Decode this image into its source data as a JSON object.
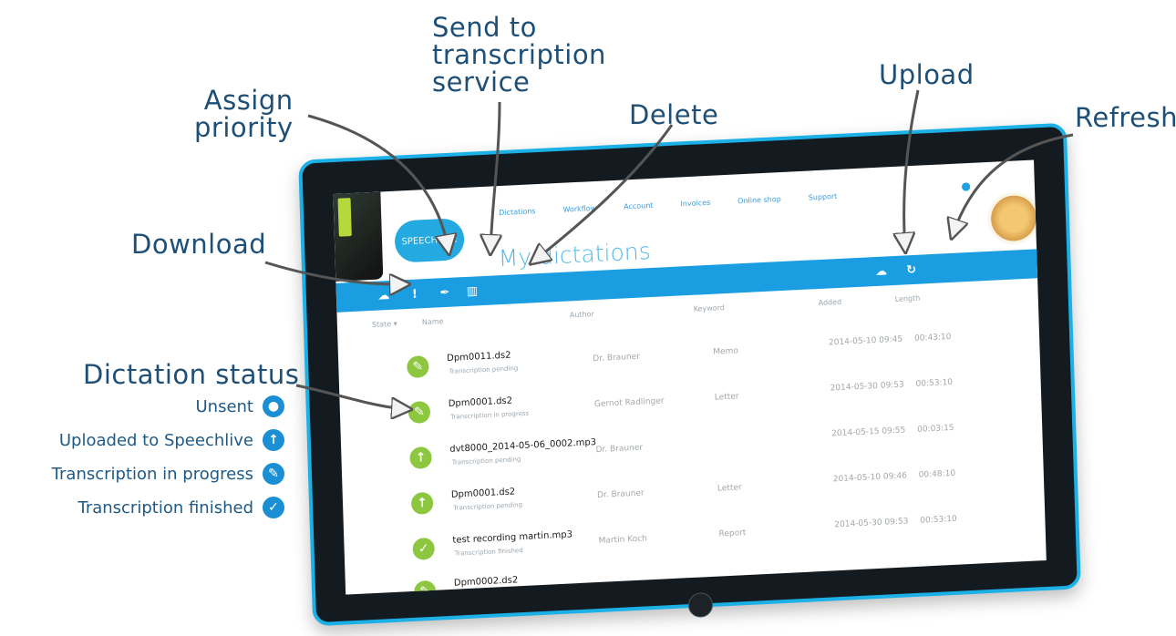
{
  "callouts": {
    "send": "Send to\ntranscription\nservice",
    "priority": "Assign\npriority",
    "delete": "Delete",
    "upload": "Upload",
    "refresh": "Refresh",
    "download": "Download",
    "dictation_status": "Dictation status"
  },
  "legend": [
    {
      "label": "Unsent",
      "icon": "microphone-icon"
    },
    {
      "label": "Uploaded to Speechlive",
      "icon": "upload-arrow-icon"
    },
    {
      "label": "Transcription in progress",
      "icon": "pencil-icon"
    },
    {
      "label": "Transcription finished",
      "icon": "checkmark-icon"
    }
  ],
  "app": {
    "logo": "SPEECHLIVE",
    "nav": [
      "Dictations",
      "Workflow",
      "Account",
      "Invoices",
      "Online shop",
      "Support"
    ],
    "page_title": "My dictations",
    "columns": [
      "State ▾",
      "Name",
      "Author",
      "Keyword",
      "Added",
      "Length"
    ]
  },
  "rows": [
    {
      "name": "Dpm0011.ds2",
      "status": "Transcription pending",
      "author": "Dr. Brauner",
      "keyword": "Memo",
      "added": "2014-05-10 09:45",
      "length": "00:43:10",
      "state": "pencil-icon"
    },
    {
      "name": "Dpm0001.ds2",
      "status": "Transcription in progress",
      "author": "Gernot Radlinger",
      "keyword": "Letter",
      "added": "2014-05-30 09:53",
      "length": "00:53:10",
      "state": "pencil-icon"
    },
    {
      "name": "dvt8000_2014-05-06_0002.mp3",
      "status": "Transcription pending",
      "author": "Dr. Brauner",
      "keyword": "",
      "added": "2014-05-15 09:55",
      "length": "00:03:15",
      "state": "upload-arrow-icon"
    },
    {
      "name": "Dpm0001.ds2",
      "status": "Transcription pending",
      "author": "Dr. Brauner",
      "keyword": "Letter",
      "added": "2014-05-10 09:46",
      "length": "00:48:10",
      "state": "upload-arrow-icon"
    },
    {
      "name": "test recording martin.mp3",
      "status": "Transcription finished",
      "author": "Martin Koch",
      "keyword": "Report",
      "added": "2014-05-30 09:53",
      "length": "00:53:10",
      "state": "checkmark-icon"
    },
    {
      "name": "Dpm0002.ds2",
      "status": "",
      "author": "",
      "keyword": "",
      "added": "",
      "length": "",
      "state": "pencil-icon"
    }
  ],
  "colors": {
    "accent": "#1a9ee1",
    "status_green": "#8dc63f",
    "callout_blue": "#1e4f76",
    "legend_blue": "#1a8fd3"
  }
}
